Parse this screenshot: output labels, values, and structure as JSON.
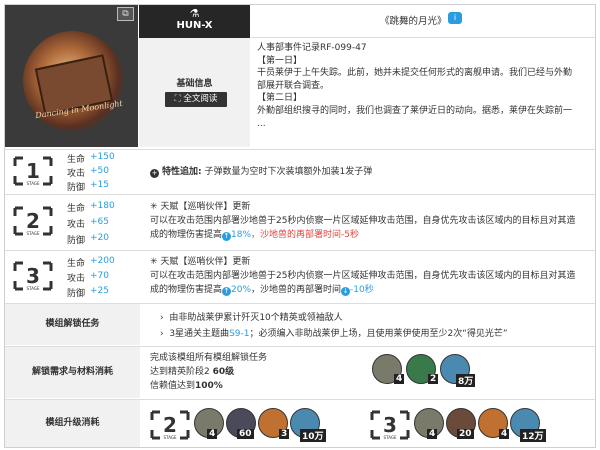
{
  "header": {
    "image_caption": "Dancing in Moonlight",
    "toggle_icon": "image-toggle-icon",
    "faction_logo": "hun-x-logo",
    "faction": "HUN-X",
    "title": "《跳舞的月光》",
    "info_icon": "info-icon"
  },
  "basic_info": {
    "label": "基础信息",
    "read_full_button": "全文阅读",
    "story_lines": [
      "人事部事件记录RF-099-47",
      "【第一日】",
      "干员莱伊于上午失踪。此前，她并未提交任何形式的离舰申请。我们已经与外勤",
      "部展开联合调查。",
      "【第二日】",
      "外勤部组织搜寻的同时，我们也调查了莱伊近日的动向。据悉，莱伊在失踪前一",
      "..."
    ]
  },
  "stages": [
    {
      "stage": "1",
      "stage_label": "STAGE",
      "stats": [
        {
          "label": "生命",
          "value": "+150"
        },
        {
          "label": "攻击",
          "value": "+50"
        },
        {
          "label": "防御",
          "value": "+15"
        }
      ],
      "trait_label": "特性追加:",
      "trait_text": "子弹数量为空时下次装填额外加装1发子弹"
    },
    {
      "stage": "2",
      "stage_label": "STAGE",
      "stats": [
        {
          "label": "生命",
          "value": "+180"
        },
        {
          "label": "攻击",
          "value": "+65"
        },
        {
          "label": "防御",
          "value": "+20"
        }
      ],
      "talent_title": "天赋【巡哨伙伴】更新",
      "talent_line1": "可以在攻击范围内部署沙地兽于25秒内侦察一片区域延伸攻击范围，自身优先攻击该区域内的目标且对其造",
      "talent_line2_a": "成的物理伤害提高",
      "talent_line2_b": "18%",
      "talent_line2_c": "，沙地兽的再部署时间-5秒"
    },
    {
      "stage": "3",
      "stage_label": "STAGE",
      "stats": [
        {
          "label": "生命",
          "value": "+200"
        },
        {
          "label": "攻击",
          "value": "+70"
        },
        {
          "label": "防御",
          "value": "+25"
        }
      ],
      "talent_title": "天赋【巡哨伙伴】更新",
      "talent_line1": "可以在攻击范围内部署沙地兽于25秒内侦察一片区域延伸攻击范围，自身优先攻击该区域内的目标且对其造",
      "talent_line2_a": "成的物理伤害提高",
      "talent_line2_b": "20%",
      "talent_line2_c": "，沙地兽的再部署时间",
      "talent_line2_d": "-10秒"
    }
  ],
  "unlock_tasks": {
    "label": "模组解锁任务",
    "task1": "由非助战莱伊累计歼灭10个精英或领袖敌人",
    "task2_a": "3星通关主题曲",
    "task2_b": "S9-1",
    "task2_c": "；必须编入非助战莱伊上场，且使用莱伊使用至少2次“得见光芒”"
  },
  "unlock_req": {
    "label": "解锁需求与材料消耗",
    "line1": "完成该模组所有模组解锁任务",
    "line2_a": "达到精英阶段2",
    "line2_b": "60级",
    "line3_a": "信赖值达到",
    "line3_b": "100%",
    "materials": [
      {
        "icon": "module-data-block-icon",
        "count": "4"
      },
      {
        "icon": "intermediate-material-icon",
        "count": "2"
      },
      {
        "icon": "lmd-icon",
        "count": "8万"
      }
    ]
  },
  "upgrade": {
    "label": "模组升级消耗",
    "stage2": {
      "stage": "2",
      "stage_label": "STAGE",
      "materials": [
        {
          "icon": "module-data-block-icon",
          "count": "4"
        },
        {
          "icon": "intermediate-material-icon",
          "count": "60"
        },
        {
          "icon": "material-icon",
          "count": "3"
        },
        {
          "icon": "lmd-icon",
          "count": "10万"
        }
      ]
    },
    "stage3": {
      "stage": "3",
      "stage_label": "STAGE",
      "materials": [
        {
          "icon": "module-data-block-icon",
          "count": "4"
        },
        {
          "icon": "intermediate-material-icon",
          "count": "20"
        },
        {
          "icon": "material-icon",
          "count": "4"
        },
        {
          "icon": "lmd-icon",
          "count": "12万"
        }
      ]
    }
  },
  "colors": {
    "accent": "#2a9de0",
    "warning": "#e2443c",
    "dark": "#262626",
    "panel": "#f1f1f1"
  }
}
